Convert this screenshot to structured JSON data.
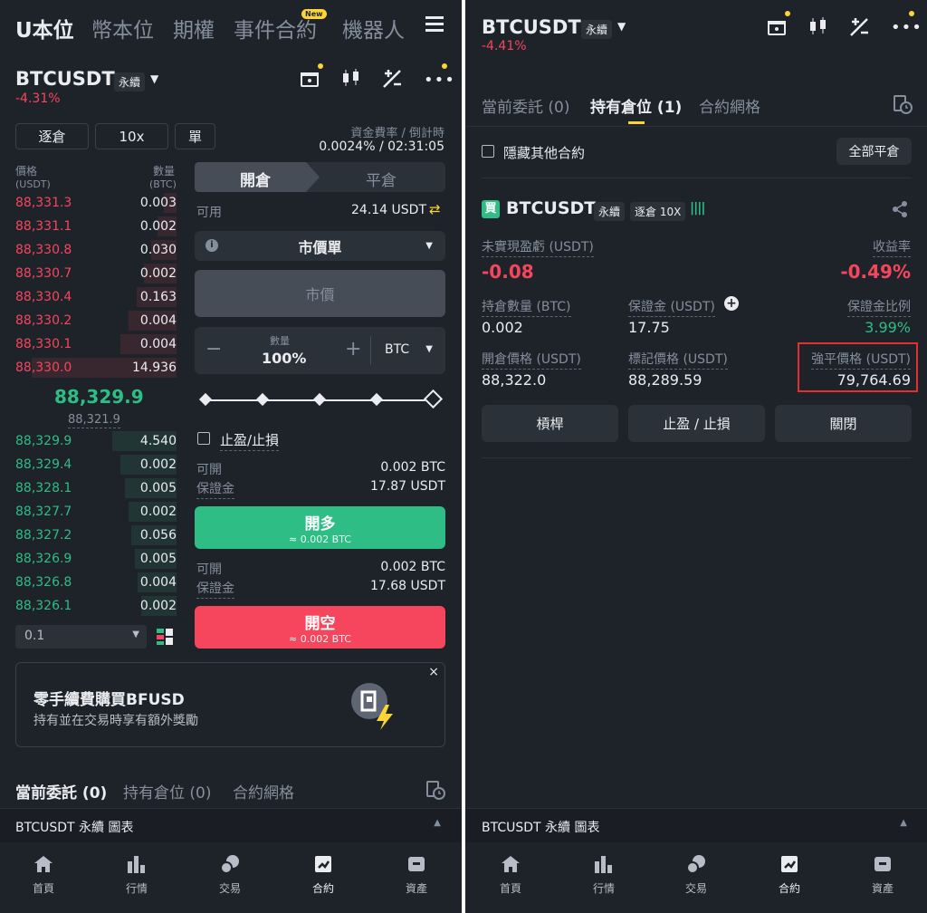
{
  "left": {
    "top_tabs": [
      "U本位",
      "幣本位",
      "期權",
      "事件合約",
      "機器人"
    ],
    "new_badge": "New",
    "symbol": "BTCUSDT",
    "symbol_tag": "永續",
    "change": "-4.31%",
    "margin_mode": "逐倉",
    "leverage": "10x",
    "position_mode": "單",
    "funding_label": "資金費率 / 倒計時",
    "funding_value": "0.0024% / 02:31:05",
    "ob_price_header": "價格",
    "ob_price_unit": "(USDT)",
    "ob_qty_header": "數量",
    "ob_qty_unit": "(BTC)",
    "asks": [
      {
        "price": "88,331.3",
        "qty": "0.003",
        "depth": 0.08
      },
      {
        "price": "88,331.1",
        "qty": "0.002",
        "depth": 0.12
      },
      {
        "price": "88,330.8",
        "qty": "0.030",
        "depth": 0.16
      },
      {
        "price": "88,330.7",
        "qty": "0.002",
        "depth": 0.2
      },
      {
        "price": "88,330.4",
        "qty": "0.163",
        "depth": 0.25
      },
      {
        "price": "88,330.2",
        "qty": "0.004",
        "depth": 0.3
      },
      {
        "price": "88,330.1",
        "qty": "0.004",
        "depth": 0.35
      },
      {
        "price": "88,330.0",
        "qty": "14.936",
        "depth": 0.9
      }
    ],
    "last_price": "88,329.9",
    "mark_price": "88,321.9",
    "bids": [
      {
        "price": "88,329.9",
        "qty": "4.540",
        "depth": 0.4
      },
      {
        "price": "88,329.4",
        "qty": "0.002",
        "depth": 0.35
      },
      {
        "price": "88,328.1",
        "qty": "0.005",
        "depth": 0.32
      },
      {
        "price": "88,327.7",
        "qty": "0.002",
        "depth": 0.3
      },
      {
        "price": "88,327.2",
        "qty": "0.056",
        "depth": 0.28
      },
      {
        "price": "88,326.9",
        "qty": "0.005",
        "depth": 0.26
      },
      {
        "price": "88,326.8",
        "qty": "0.004",
        "depth": 0.24
      },
      {
        "price": "88,326.1",
        "qty": "0.002",
        "depth": 0.22
      }
    ],
    "precision": "0.1",
    "open_tab": "開倉",
    "close_tab": "平倉",
    "available_label": "可用",
    "available_value": "24.14 USDT",
    "order_type": "市價單",
    "price_placeholder": "市價",
    "qty_label": "數量",
    "qty_value": "100%",
    "qty_unit": "BTC",
    "tpsl_label": "止盈/止損",
    "long_can_open_label": "可開",
    "long_can_open_value": "0.002 BTC",
    "long_margin_label": "保證金",
    "long_margin_value": "17.87 USDT",
    "long_btn": "開多",
    "long_btn_sub": "≈ 0.002 BTC",
    "short_can_open_label": "可開",
    "short_can_open_value": "0.002 BTC",
    "short_margin_label": "保證金",
    "short_margin_value": "17.68 USDT",
    "short_btn": "開空",
    "short_btn_sub": "≈ 0.002 BTC",
    "promo_title": "零手續費購買BFUSD",
    "promo_sub": "持有並在交易時享有額外獎勵",
    "bottom_tabs": [
      "當前委託 (0)",
      "持有倉位 (0)",
      "合約網格"
    ],
    "chart_bar": "BTCUSDT 永續  圖表"
  },
  "right": {
    "symbol": "BTCUSDT",
    "symbol_tag": "永續",
    "change": "-4.41%",
    "tabs": [
      "當前委託 (0)",
      "持有倉位 (1)",
      "合約網格"
    ],
    "hide_other": "隱藏其他合約",
    "close_all": "全部平倉",
    "pos_side": "買",
    "pos_symbol": "BTCUSDT",
    "pos_tag1": "永續",
    "pos_tag2": "逐倉 10X",
    "upnl_label": "未實現盈虧 (USDT)",
    "upnl_value": "-0.08",
    "roe_label": "收益率",
    "roe_value": "-0.49%",
    "size_label": "持倉數量 (BTC)",
    "size_value": "0.002",
    "margin_label": "保證金 (USDT)",
    "margin_value": "17.75",
    "margin_ratio_label": "保證金比例",
    "margin_ratio_value": "3.99%",
    "entry_label": "開倉價格 (USDT)",
    "entry_value": "88,322.0",
    "mark_label": "標記價格 (USDT)",
    "mark_value": "88,289.59",
    "liq_label": "強平價格 (USDT)",
    "liq_value": "79,764.69",
    "btn_leverage": "槓桿",
    "btn_tpsl": "止盈 / 止損",
    "btn_close": "關閉",
    "chart_bar": "BTCUSDT 永續  圖表"
  },
  "nav": [
    "首頁",
    "行情",
    "交易",
    "合約",
    "資產"
  ],
  "colors": {
    "bg": "#1e2329",
    "green": "#2ebd85",
    "red": "#f6465d",
    "accent": "#fcd535"
  }
}
